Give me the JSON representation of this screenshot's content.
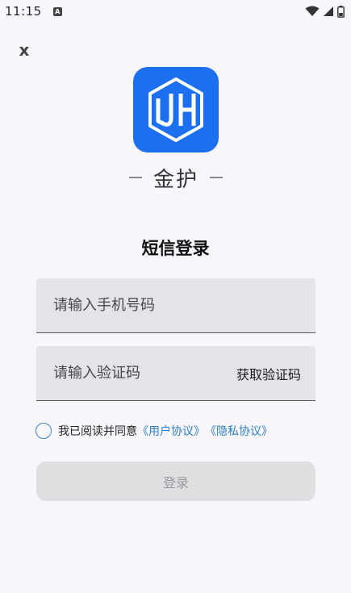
{
  "status_bar": {
    "time": "11:15",
    "notification_icon": "a-notification-icon",
    "notification_glyph": "A",
    "icons": [
      "wifi-icon",
      "signal-icon",
      "battery-icon"
    ]
  },
  "close_label": "x",
  "brand": {
    "logo_icon": "jh-logo-icon",
    "name": "金护",
    "accent_color": "#1c6ff0"
  },
  "title": "短信登录",
  "phone": {
    "value": "",
    "placeholder": "请输入手机号码"
  },
  "code": {
    "value": "",
    "placeholder": "请输入验证码",
    "get_code_label": "获取验证码"
  },
  "agreement": {
    "checked": false,
    "text": "我已阅读并同意",
    "user_agreement": "《用户协议》",
    "privacy_agreement": "《隐私协议》",
    "link_color": "#2d7fc4"
  },
  "login_label": "登录"
}
